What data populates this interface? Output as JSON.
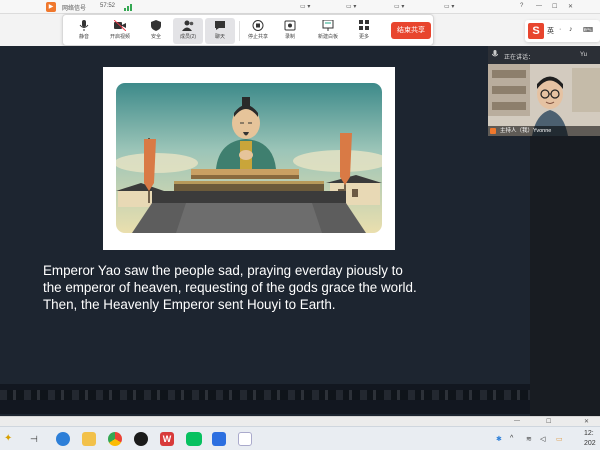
{
  "header": {
    "network_label": "网络信号",
    "time": "57:52"
  },
  "toolbar": {
    "items": [
      {
        "label": "静音"
      },
      {
        "label": "开启视频"
      },
      {
        "label": "安全"
      },
      {
        "label": "成员(2)"
      },
      {
        "label": "聊天"
      },
      {
        "label": "停止共享"
      },
      {
        "label": "录制"
      },
      {
        "label": "新建白板"
      },
      {
        "label": "更多"
      }
    ],
    "end_label": "结束共享"
  },
  "tray": {
    "logo": "S",
    "items": [
      "英",
      "·",
      "♪",
      "⌨"
    ]
  },
  "slide": {
    "caption_lines": [
      "Emperor Yao saw the people sad, praying everday piously to",
      "the emperor of heaven, requesting of the gods grace the world.",
      "Then, the Heavenly Emperor sent Houyi to Earth."
    ]
  },
  "participant": {
    "header_left": "正在讲话：",
    "header_right": "Yu",
    "video_label": "主持人（我）Yvonne"
  },
  "taskbar": {
    "time": "12:",
    "date": "202"
  }
}
